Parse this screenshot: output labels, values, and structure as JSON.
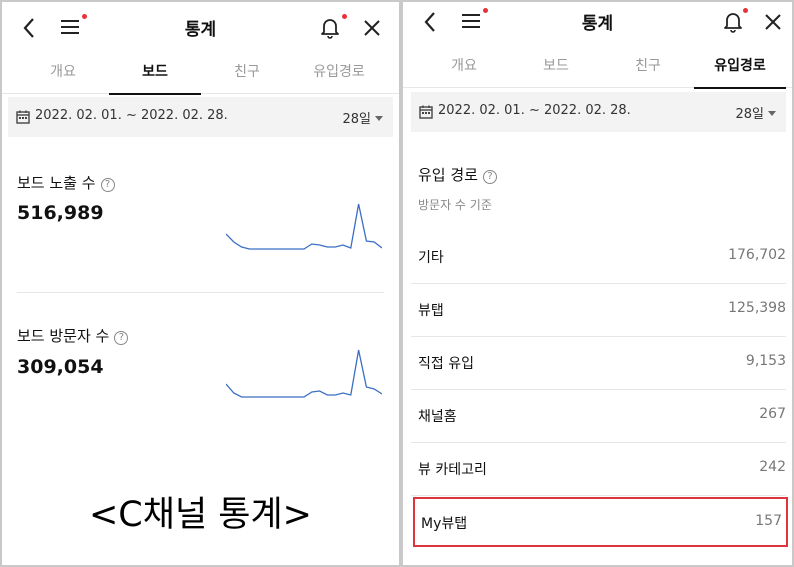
{
  "colors": {
    "accent_dot": "#e8323a",
    "sparkline": "#3a6fc4",
    "highlight": "#e0353a"
  },
  "left": {
    "title": "통계",
    "tabs": [
      {
        "label": "개요",
        "active": false
      },
      {
        "label": "보드",
        "active": true
      },
      {
        "label": "친구",
        "active": false
      },
      {
        "label": "유입경로",
        "active": false
      }
    ],
    "date_range": "2022. 02. 01. ~ 2022. 02. 28.",
    "period": "28일",
    "stats": [
      {
        "label": "보드 노출 수",
        "value": "516,989",
        "sparkline": [
          30,
          22,
          17,
          15,
          15,
          15,
          15,
          15,
          15,
          15,
          15,
          20,
          19,
          17,
          17,
          19,
          16,
          60,
          23,
          22,
          16
        ]
      },
      {
        "label": "보드 방문자 수",
        "value": "309,054",
        "sparkline": [
          30,
          21,
          17,
          17,
          17,
          17,
          17,
          17,
          17,
          17,
          17,
          22,
          23,
          19,
          19,
          21,
          19,
          64,
          27,
          25,
          20
        ]
      }
    ],
    "caption": "<C채널 통계>"
  },
  "right": {
    "title": "통계",
    "tabs": [
      {
        "label": "개요",
        "active": false
      },
      {
        "label": "보드",
        "active": false
      },
      {
        "label": "친구",
        "active": false
      },
      {
        "label": "유입경로",
        "active": true
      }
    ],
    "date_range": "2022. 02. 01. ~ 2022. 02. 28.",
    "period": "28일",
    "section_title": "유입 경로",
    "section_sub": "방문자 수 기준",
    "rows": [
      {
        "label": "기타",
        "value": "176,702"
      },
      {
        "label": "뷰탭",
        "value": "125,398"
      },
      {
        "label": "직접 유입",
        "value": "9,153"
      },
      {
        "label": "채널홈",
        "value": "267"
      },
      {
        "label": "뷰 카테고리",
        "value": "242"
      },
      {
        "label": "My뷰탭",
        "value": "157"
      }
    ]
  }
}
